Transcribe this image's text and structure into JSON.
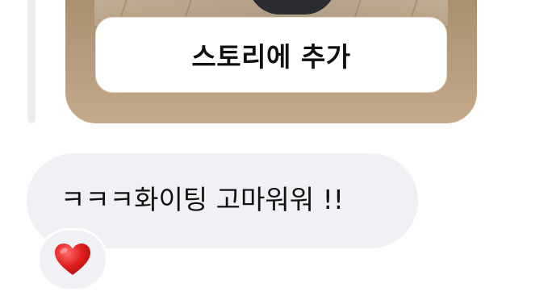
{
  "story_card": {
    "add_to_story_label": "스토리에 추가"
  },
  "message": {
    "text": "ㅋㅋㅋ화이팅 고마워워 !!"
  },
  "reaction": {
    "emoji_icon": "red-heart-icon",
    "accent_color": "#e0201f"
  },
  "colors": {
    "bubble_background": "#f0f1f4",
    "story_frame": "#b69c7a",
    "text": "#111111"
  }
}
